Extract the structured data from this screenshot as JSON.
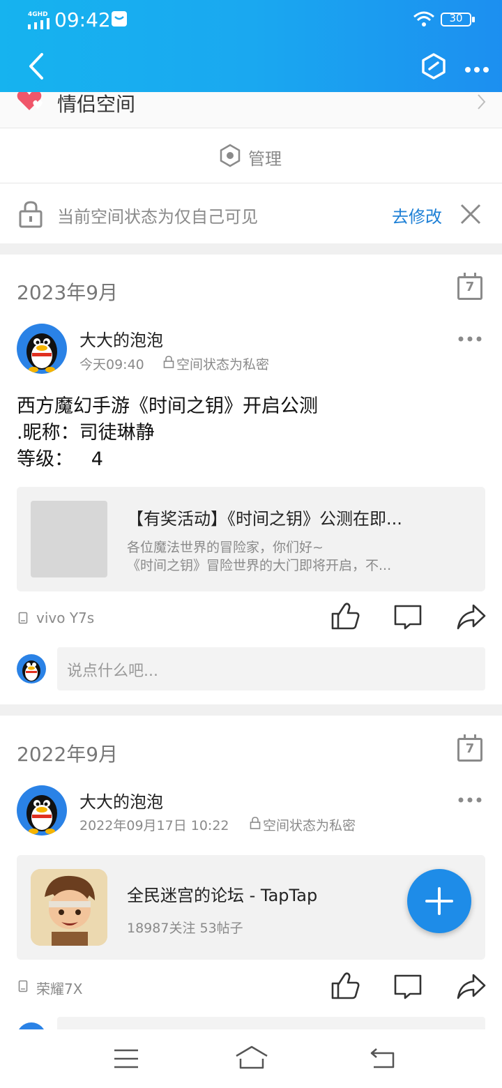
{
  "status_bar": {
    "network": "4GHD",
    "time": "09:42",
    "battery": "30"
  },
  "header": {
    "back": "back",
    "hex_icon": "hexagon-icon",
    "more": "more"
  },
  "top_row": {
    "label": "情侣空间"
  },
  "manage": {
    "label": "管理"
  },
  "notice": {
    "text": "当前空间状态为仅自己可见",
    "action": "去修改"
  },
  "posts": [
    {
      "month": "2023年9月",
      "calendar_day": "7",
      "author": "大大的泡泡",
      "time": "今天09:40",
      "privacy": "空间状态为私密",
      "lines": [
        "西方魔幻手游《时间之钥》开启公测",
        ".昵称：司徒琳静",
        "等级：   4"
      ],
      "share": {
        "title": "【有奖活动】《时间之钥》公测在即...",
        "desc1": "各位魔法世界的冒险家，你们好~",
        "desc2": "《时间之钥》冒险世界的大门即将开启，不..."
      },
      "device": "vivo Y7s",
      "comment_placeholder": "说点什么吧..."
    },
    {
      "month": "2022年9月",
      "calendar_day": "7",
      "author": "大大的泡泡",
      "time": "2022年09月17日 10:22",
      "privacy": "空间状态为私密",
      "share": {
        "title": "全民迷宫的论坛 - TapTap",
        "desc1": "18987关注 53帖子"
      },
      "device": "荣耀7X"
    }
  ],
  "colors": {
    "accent": "#1e8ce8",
    "header_start": "#16b3ef",
    "fab": "#1e8ce8"
  }
}
